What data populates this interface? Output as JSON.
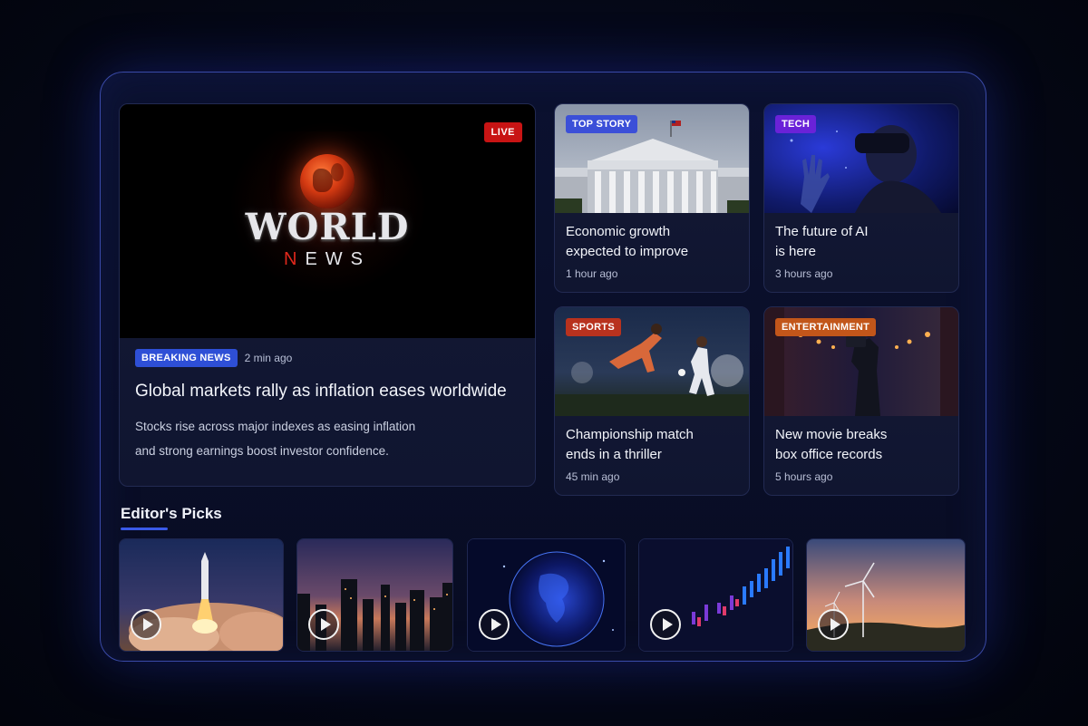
{
  "hero": {
    "brand_word1": "WORLD",
    "brand_word2_first": "N",
    "brand_word2_rest": "EWS",
    "live_label": "LIVE",
    "badge": "BREAKING NEWS",
    "time": "2 min ago",
    "title": "Global markets rally as inflation eases worldwide",
    "desc_line1": "Stocks rise across major indexes as easing inflation",
    "desc_line2": "and strong earnings boost investor confidence."
  },
  "cards": [
    {
      "badge": "TOP STORY",
      "badge_color": "#3b4fd8",
      "title_line1": "Economic growth",
      "title_line2": "expected to improve",
      "time": "1 hour ago"
    },
    {
      "badge": "TECH",
      "badge_color": "#6a22d8",
      "title_line1": "The future of AI",
      "title_line2": "is here",
      "time": "3 hours ago"
    },
    {
      "badge": "SPORTS",
      "badge_color": "#b8321e",
      "title_line1": "Championship match",
      "title_line2": "ends in a thriller",
      "time": "45 min ago"
    },
    {
      "badge": "ENTERTAINMENT",
      "badge_color": "#c2561a",
      "title_line1": "New movie breaks",
      "title_line2": "box office records",
      "time": "5 hours ago"
    }
  ],
  "editors_picks": {
    "title": "Editor's Picks"
  },
  "colors": {
    "accent": "#3a5ae8",
    "live": "#c81414",
    "breaking": "#2e4fd6"
  }
}
